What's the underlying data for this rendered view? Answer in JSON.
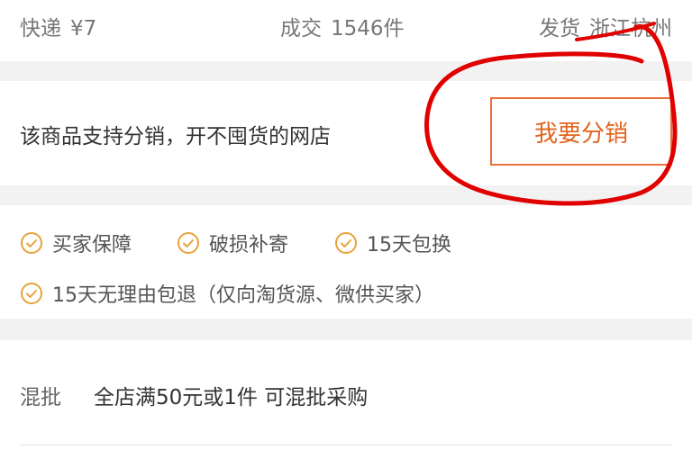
{
  "info": {
    "shipping_label": "快递",
    "shipping_value": "¥7",
    "sold_label": "成交",
    "sold_value": "1546件",
    "origin_label": "发货",
    "origin_value": "浙江杭州"
  },
  "distribution": {
    "text": "该商品支持分销，开不囤货的网店",
    "button_label": "我要分销"
  },
  "guarantees": [
    "买家保障",
    "破损补寄",
    "15天包换",
    "15天无理由包退（仅向淘货源、微供买家）"
  ],
  "mixed": {
    "label": "混批",
    "text": "全店满50元或1件 可混批采购"
  },
  "colors": {
    "accent": "#e2651f",
    "check": "#e8a23a",
    "annotation": "#e00000"
  }
}
